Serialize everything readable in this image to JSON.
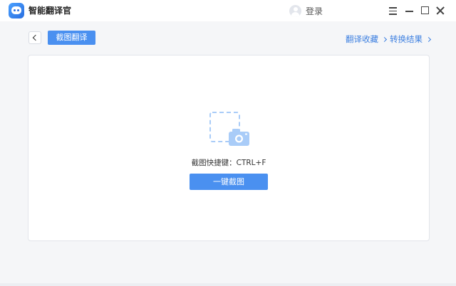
{
  "app": {
    "title": "智能翻译官",
    "login_label": "登录"
  },
  "toolbar": {
    "active_tab_label": "截图翻译",
    "favorites_link": "翻译收藏",
    "results_link": "转换结果"
  },
  "main": {
    "shortcut_hint": "截图快捷键：CTRL+F",
    "capture_button_label": "一键截图"
  },
  "icons": {
    "back": "chevron-left-icon",
    "capture": "screenshot-camera-icon",
    "avatar": "user-avatar-icon"
  },
  "colors": {
    "accent": "#4a90f0",
    "link": "#3c7fe0",
    "icon_light": "#a9ccf8"
  }
}
